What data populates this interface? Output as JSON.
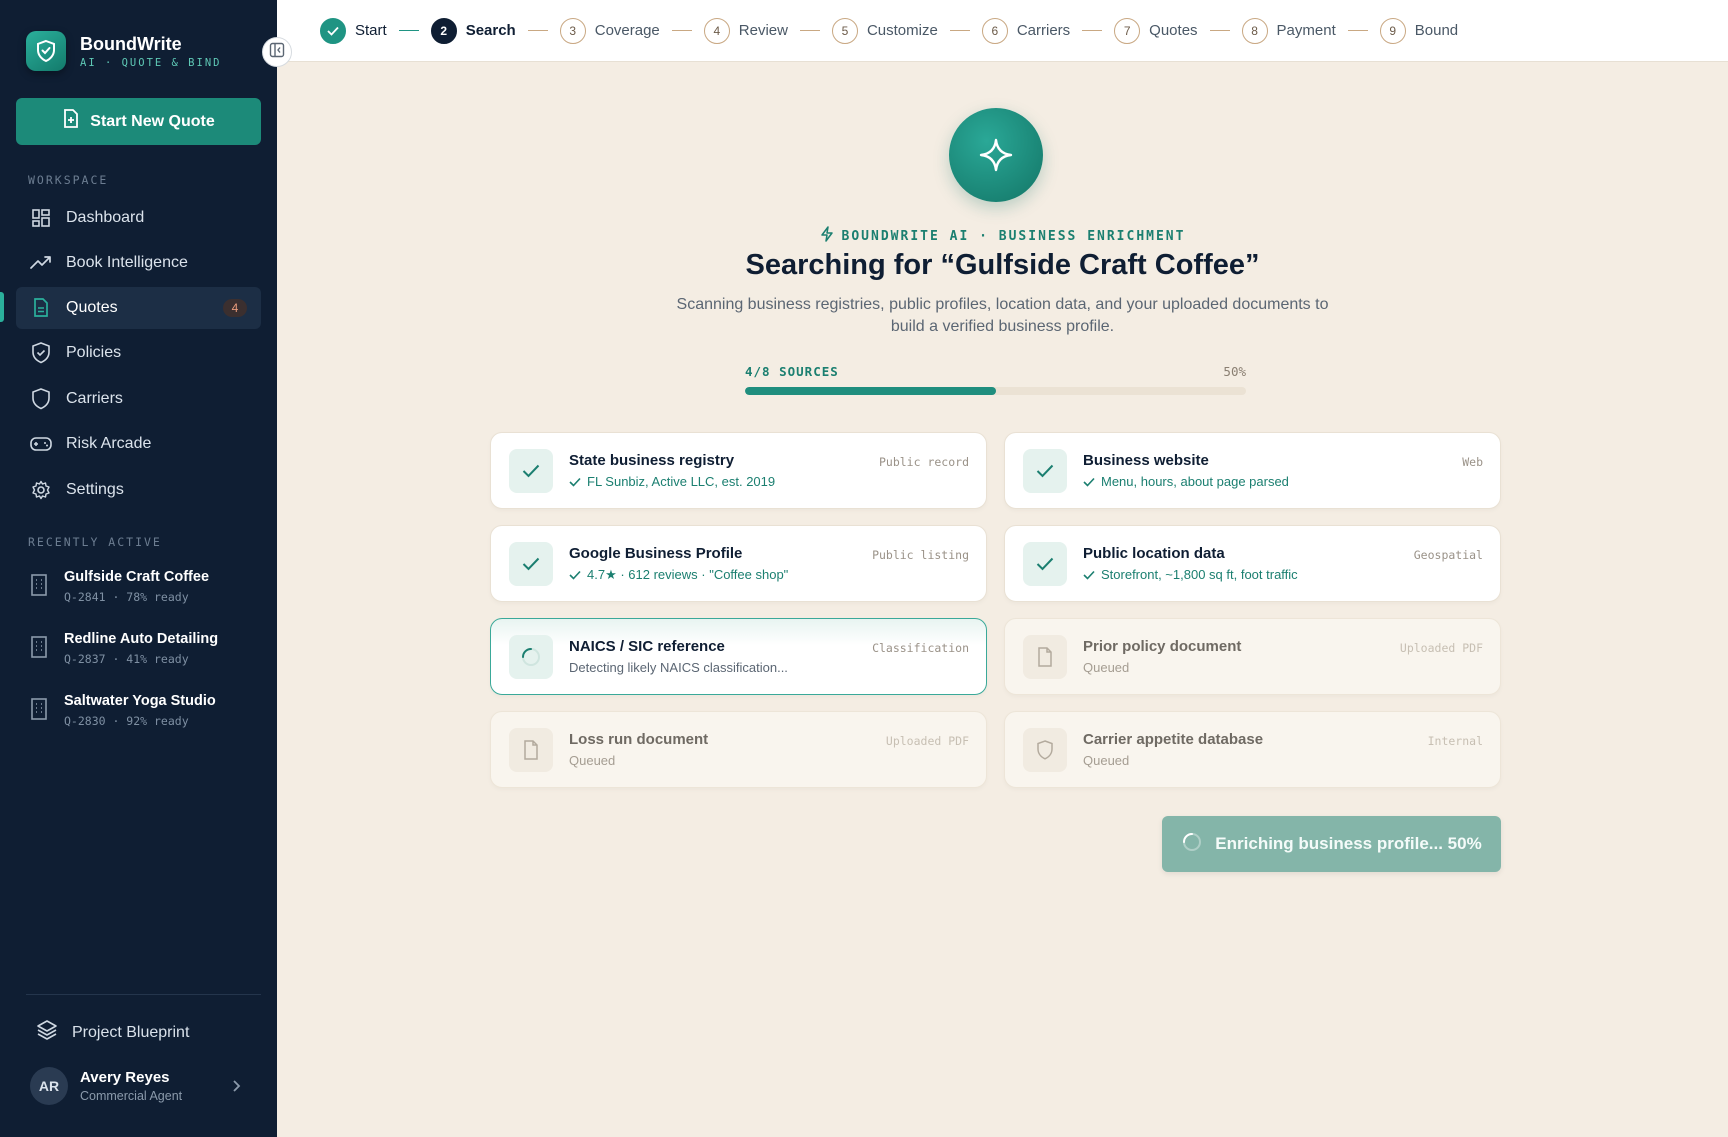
{
  "brand": {
    "name": "BoundWrite",
    "tagline": "AI · QUOTE & BIND"
  },
  "sidebar": {
    "new_quote_label": "Start New Quote",
    "workspace_label": "WORKSPACE",
    "items": [
      {
        "label": "Dashboard",
        "icon": "dashboard-icon"
      },
      {
        "label": "Book Intelligence",
        "icon": "trend-icon"
      },
      {
        "label": "Quotes",
        "icon": "document-icon",
        "badge": "4",
        "active": true
      },
      {
        "label": "Policies",
        "icon": "shield-check-icon"
      },
      {
        "label": "Carriers",
        "icon": "shield-icon"
      },
      {
        "label": "Risk Arcade",
        "icon": "gamepad-icon"
      },
      {
        "label": "Settings",
        "icon": "gear-icon"
      }
    ],
    "recent_label": "RECENTLY ACTIVE",
    "recent": [
      {
        "title": "Gulfside Craft Coffee",
        "sub": "Q-2841 · 78% ready"
      },
      {
        "title": "Redline Auto Detailing",
        "sub": "Q-2837 · 41% ready"
      },
      {
        "title": "Saltwater Yoga Studio",
        "sub": "Q-2830 · 92% ready"
      }
    ],
    "blueprint_label": "Project Blueprint",
    "user": {
      "initials": "AR",
      "name": "Avery Reyes",
      "role": "Commercial Agent"
    }
  },
  "stepper": [
    {
      "num": "",
      "label": "Start",
      "state": "done"
    },
    {
      "num": "2",
      "label": "Search",
      "state": "current"
    },
    {
      "num": "3",
      "label": "Coverage",
      "state": "todo"
    },
    {
      "num": "4",
      "label": "Review",
      "state": "todo"
    },
    {
      "num": "5",
      "label": "Customize",
      "state": "todo"
    },
    {
      "num": "6",
      "label": "Carriers",
      "state": "todo"
    },
    {
      "num": "7",
      "label": "Quotes",
      "state": "todo"
    },
    {
      "num": "8",
      "label": "Payment",
      "state": "todo"
    },
    {
      "num": "9",
      "label": "Bound",
      "state": "todo"
    }
  ],
  "main": {
    "eyebrow": "BOUNDWRITE AI · BUSINESS ENRICHMENT",
    "title": "Searching for “Gulfside Craft Coffee”",
    "subtitle": "Scanning business registries, public profiles, location data, and your uploaded documents to build a verified business profile.",
    "progress_label": "4/8 SOURCES",
    "progress_pct_label": "50%",
    "progress_fraction": 0.5,
    "sources": [
      {
        "title": "State business registry",
        "detail": "FL Sunbiz, Active LLC, est. 2019",
        "tag": "Public record",
        "state": "done"
      },
      {
        "title": "Business website",
        "detail": "Menu, hours, about page parsed",
        "tag": "Web",
        "state": "done"
      },
      {
        "title": "Google Business Profile",
        "detail": "4.7★ · 612 reviews · \"Coffee shop\"",
        "tag": "Public listing",
        "state": "done"
      },
      {
        "title": "Public location data",
        "detail": "Storefront, ~1,800 sq ft, foot traffic",
        "tag": "Geospatial",
        "state": "done"
      },
      {
        "title": "NAICS / SIC reference",
        "detail": "Detecting likely NAICS classification...",
        "tag": "Classification",
        "state": "active"
      },
      {
        "title": "Prior policy document",
        "detail": "Queued",
        "tag": "Uploaded PDF",
        "state": "queued",
        "icon": "file-icon"
      },
      {
        "title": "Loss run document",
        "detail": "Queued",
        "tag": "Uploaded PDF",
        "state": "queued",
        "icon": "file-icon"
      },
      {
        "title": "Carrier appetite database",
        "detail": "Queued",
        "tag": "Internal",
        "state": "queued",
        "icon": "shield-icon"
      }
    ],
    "enrich_button": "Enriching business profile... 50%"
  },
  "colors": {
    "accent": "#1f8e7e",
    "sidebar": "#0f1e33",
    "background": "#f4ede3"
  }
}
